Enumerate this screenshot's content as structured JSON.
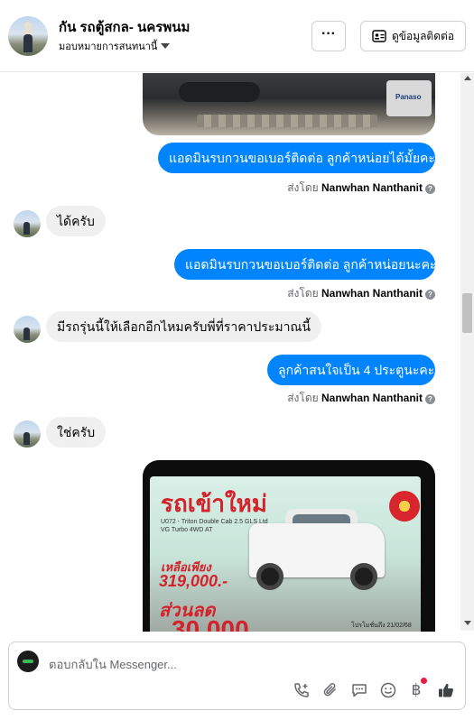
{
  "header": {
    "title": "กัน รถตู้สกล- นครพนม",
    "subtitle": "มอบหมายการสนทนานี้",
    "more_label": "···",
    "contact_label": "ดูข้อมูลติดต่อ"
  },
  "photo_top": {
    "brand_text": "Panaso"
  },
  "messages": [
    {
      "text": "แอดมินรบกวนขอเบอร์ติดต่อ ลูกค้าหน่อยได้มั้ยคะ"
    },
    {
      "sent_prefix": "ส่งโดย",
      "sent_name": "Nanwhan Nanthanit"
    },
    {
      "text": "ได้ครับ"
    },
    {
      "text": "แอดมินรบกวนขอเบอร์ติดต่อ ลูกค้าหน่อยนะคะ"
    },
    {
      "sent_prefix": "ส่งโดย",
      "sent_name": "Nanwhan Nanthanit"
    },
    {
      "text": "มีรถรุ่นนี้ให้เลือกอีกไหมครับพี่ที่ราคาประมาณนี้"
    },
    {
      "text": "ลูกค้าสนใจเป็น 4 ประตูนะคะ"
    },
    {
      "sent_prefix": "ส่งโดย",
      "sent_name": "Nanwhan Nanthanit"
    },
    {
      "text": "ใช่ครับ"
    }
  ],
  "car_ad": {
    "headline": "รถเข้าใหม่",
    "model": "U072 - Triton Double Cab 2.5 GLS Ltd VG Turbo 4WD AT",
    "left_label": "เหลือเพียง",
    "price": "319,000.-",
    "discount_label": "ส่วนลด",
    "discount_value": "30,000",
    "date": "โปรโมชั่นถึง 21/02/68"
  },
  "composer": {
    "placeholder": "ตอบกลับใน Messenger..."
  },
  "icons": [
    "phone-plus-icon",
    "paperclip-icon",
    "quick-reply-icon",
    "emoji-icon",
    "baht-icon",
    "thumbs-up-icon"
  ],
  "colors": {
    "accent": "#0084ff",
    "incoming": "#f0f0f0",
    "notification": "#e41e3f"
  }
}
